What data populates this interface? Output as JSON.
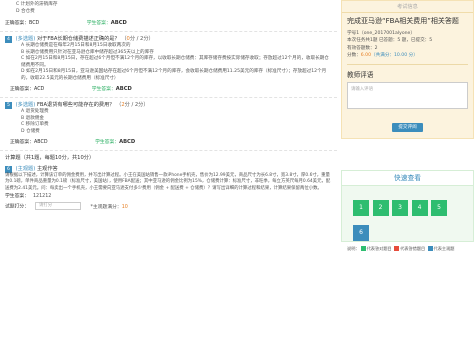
{
  "main": {
    "q_top": {
      "options": [
        "C  计划外的滞销库存",
        "D  合仓费"
      ],
      "correct_label": "正确答案：",
      "correct": "BCD",
      "student_label": "学生答案：",
      "student": "ABCD"
    },
    "q4": {
      "num": "4",
      "type": "(多选题)",
      "text": "对于FBA长期仓储费描述正确的是？",
      "score_pre": "（",
      "score_got": "0",
      "score_post": "分 / 2分）",
      "options": [
        "A  长期仓储费是在每年2月15日和8月15日收取两次的",
        "B  长期仓储费用只针对在亚马逊仓库中储存超过365天以上的库存",
        "C  如在2月15日和8月15日，存在超过6个月但不满12个月的库存，以收取长期仓储费：其库存储存费按实际储存收取；存放超过12个月的，收取长期仓储费用不同。",
        "D  如在2月15日和8月15日，亚马逊美国站存在超过6个月但不满12个月的库存，会收取长期仓储费用11.25美元的库存（标准尺寸）；存放超过12个月的，收取22.5美元的长期仓储费用（标准尺寸）"
      ],
      "correct_label": "正确答案：",
      "correct": "ACD",
      "student_label": "学生答案：",
      "student": "ABCD"
    },
    "q5": {
      "num": "5",
      "type": "(多选题)",
      "text": "FBA退货有哪些可能存在的费用？",
      "score_pre": "（",
      "score_got": "2",
      "score_post": "分 / 2分）",
      "options": [
        "A  退货处理费",
        "B  退款佣金",
        "C  移除订单费",
        "D  仓储费"
      ],
      "correct_label": "正确答案：",
      "correct": "ABCD",
      "student_label": "学生答案：",
      "student": "ABCD"
    },
    "calc_section": "计算题（共1题，每题10分，共10分）",
    "q6": {
      "num": "6",
      "type": "(主观题)",
      "text": "主观作答",
      "para": "请根据以下描述，计算该订单的佣金费用，并写出计算过程。小王在美国站销售一款iPhone手机壳，售价为12.99美元，商品尺寸为长6.8寸，宽3.8寸，厚0.6寸，重量为0.1磅，单件商品重量为0.1磅（标准尺寸，美国站），使用FBA配送；其中亚马逊的佣金比例为15%，仓储费计算：标准尺寸，非旺季，每立方英尺每月0.64美元，配送费为2.41美元。问：每卖出一个手机壳，小王需要向亚马逊支付多少费用（佣金 + 配送费 + 仓储费）？请写出详细的计算过程和结果，计算结果保留两位小数。",
      "student_answer_label": "学生答案：",
      "student_answer": "121212",
      "rate_label": "试题打分：",
      "rate_placeholder": "请打分",
      "max_label": "*主观题满分：",
      "max_score": "10"
    }
  },
  "side": {
    "panel_header": "考试信息",
    "exam_title": "完成亚马逊“FBA相关费用”相关答题",
    "student_line": "学号1（one_201700​1alyone）",
    "summary_line": "本次任务共1题  已答题：5  题，已提交：5",
    "answered_line": "有效答题数：2",
    "score_prefix": "分数：",
    "score_value": "6.00",
    "score_total": "（共满分：10.00 分）",
    "comment_title": "教师评语",
    "comment_placeholder": "请输入评语",
    "submit_label": "提交评阅",
    "quick_title": "快速查看",
    "cells": [
      "1",
      "2",
      "3",
      "4",
      "5",
      "6"
    ],
    "legend_prefix": "说明：",
    "legend_correct": "代表答对题目",
    "legend_wrong": "代表答错题目",
    "legend_subjective": "代表主观题"
  },
  "colors": {
    "accent": "#3c8dbc",
    "correct": "#2ebd70",
    "score": "#e67e22",
    "panel_yellow": "#fcf3de"
  }
}
